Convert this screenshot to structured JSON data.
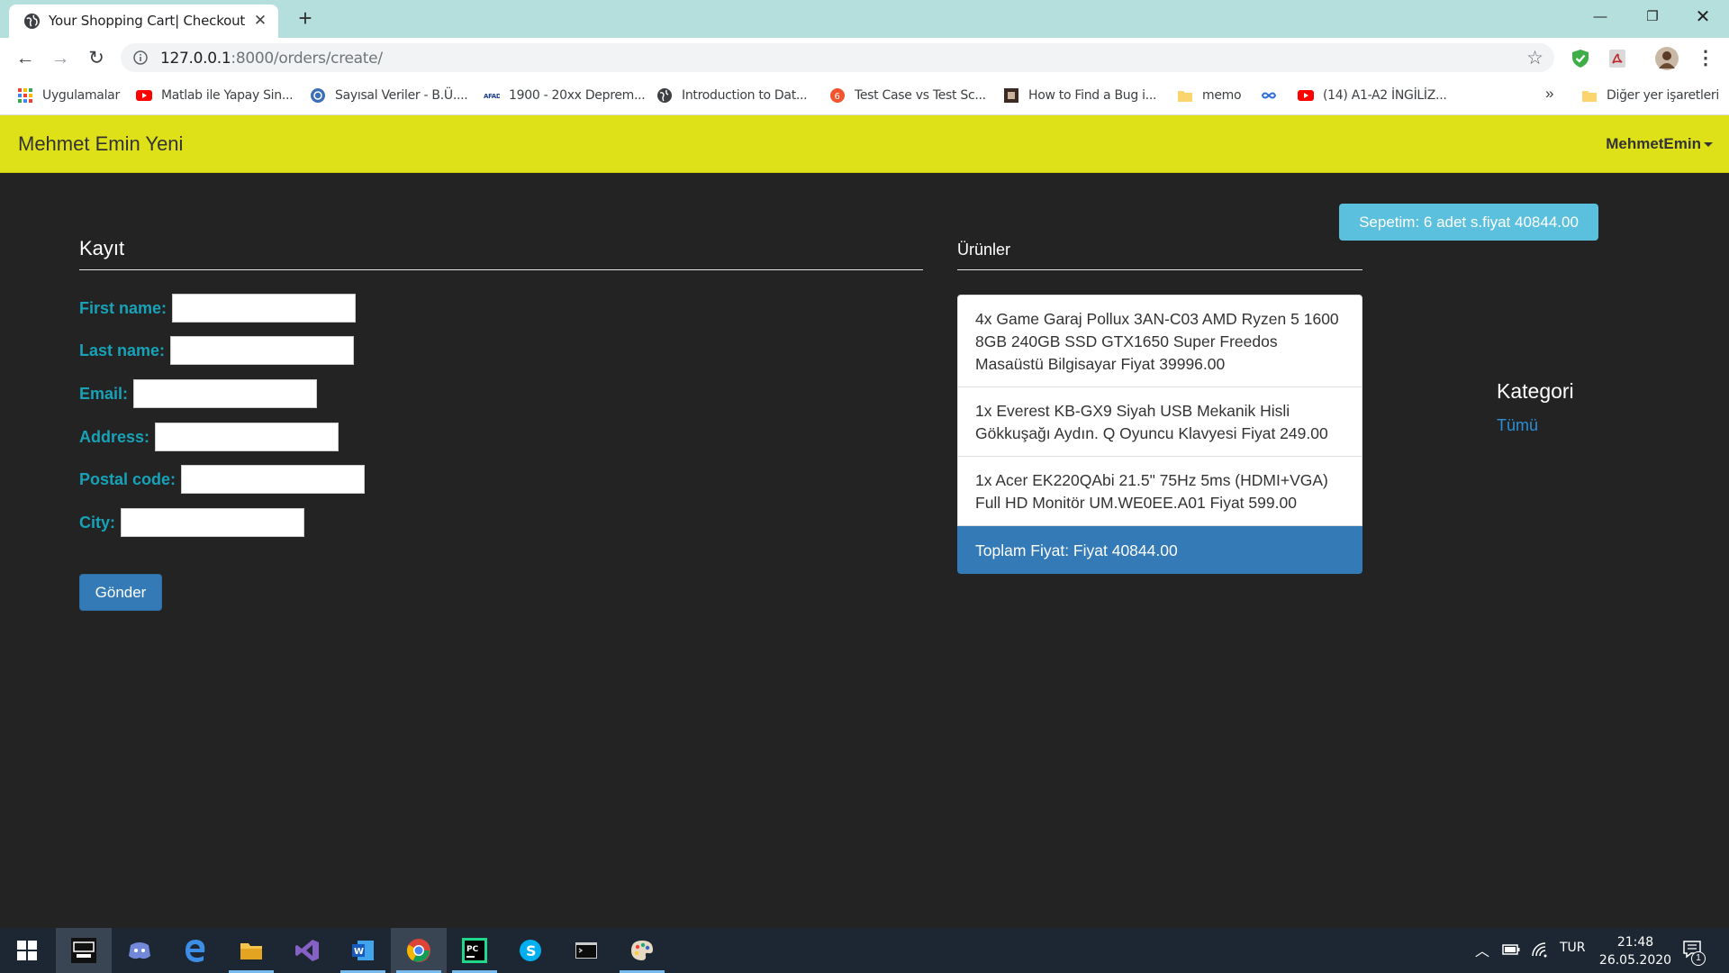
{
  "browser": {
    "tab_title": "Your Shopping Cart| Checkout",
    "url_host": "127.0.0.1",
    "url_rest": ":8000/orders/create/",
    "bookmarks": [
      {
        "label": "Uygulamalar",
        "icon": "apps-grid-icon"
      },
      {
        "label": "Matlab ile Yapay Sin...",
        "icon": "youtube-icon"
      },
      {
        "label": "Sayısal Veriler - B.Ü....",
        "icon": "globe-icon"
      },
      {
        "label": "1900 - 20xx Deprem...",
        "icon": "afad-icon"
      },
      {
        "label": "Introduction to Dat...",
        "icon": "globe-icon"
      },
      {
        "label": "Test Case vs Test Sc...",
        "icon": "orange-site-icon"
      },
      {
        "label": "How to Find a Bug i...",
        "icon": "cube-icon"
      },
      {
        "label": "memo",
        "icon": "folder-icon"
      },
      {
        "label": "",
        "icon": "infinity-icon"
      },
      {
        "label": "(14) A1-A2 İNGİLİZ...",
        "icon": "youtube-icon"
      }
    ],
    "other_bookmarks": "Diğer yer işaretleri",
    "more_bookmarks": "»"
  },
  "navbar": {
    "brand": "Mehmet Emin Yeni",
    "user": "MehmetEmin"
  },
  "cart_button": "Sepetim: 6 adet s.fiyat 40844.00",
  "form": {
    "title": "Kayıt",
    "fields": [
      {
        "label": "First name:",
        "value": ""
      },
      {
        "label": "Last name:",
        "value": ""
      },
      {
        "label": "Email:",
        "value": ""
      },
      {
        "label": "Address:",
        "value": ""
      },
      {
        "label": "Postal code:",
        "value": ""
      },
      {
        "label": "City:",
        "value": ""
      }
    ],
    "submit": "Gönder"
  },
  "products": {
    "title": "Ürünler",
    "items": [
      "4x Game Garaj Pollux 3AN-C03 AMD Ryzen 5 1600 8GB 240GB SSD GTX1650 Super Freedos Masaüstü Bilgisayar Fiyat 39996.00",
      "1x Everest KB-GX9 Siyah USB Mekanik Hisli Gökkuşağı Aydın. Q Oyuncu Klavyesi Fiyat 249.00",
      "1x Acer EK220QAbi 21.5\" 75Hz 5ms (HDMI+VGA) Full HD Monitör UM.WE0EE.A01 Fiyat 599.00"
    ],
    "total": "Toplam Fiyat: Fiyat 40844.00"
  },
  "categories": {
    "title": "Kategori",
    "link": "Tümü"
  },
  "taskbar": {
    "language": "TUR",
    "time": "21:48",
    "date": "26.05.2020",
    "notifications": "1",
    "apps": [
      "pubg-lite-icon",
      "discord-icon",
      "edge-icon",
      "file-explorer-icon",
      "visual-studio-icon",
      "word-icon",
      "chrome-icon",
      "pycharm-icon",
      "skype-icon",
      "terminal-icon",
      "paint-icon"
    ]
  },
  "colors": {
    "navbar": "#dfe118",
    "page_bg": "#232323",
    "label": "#17a2b8",
    "cart_button": "#5bc0de",
    "primary": "#337ab7"
  }
}
